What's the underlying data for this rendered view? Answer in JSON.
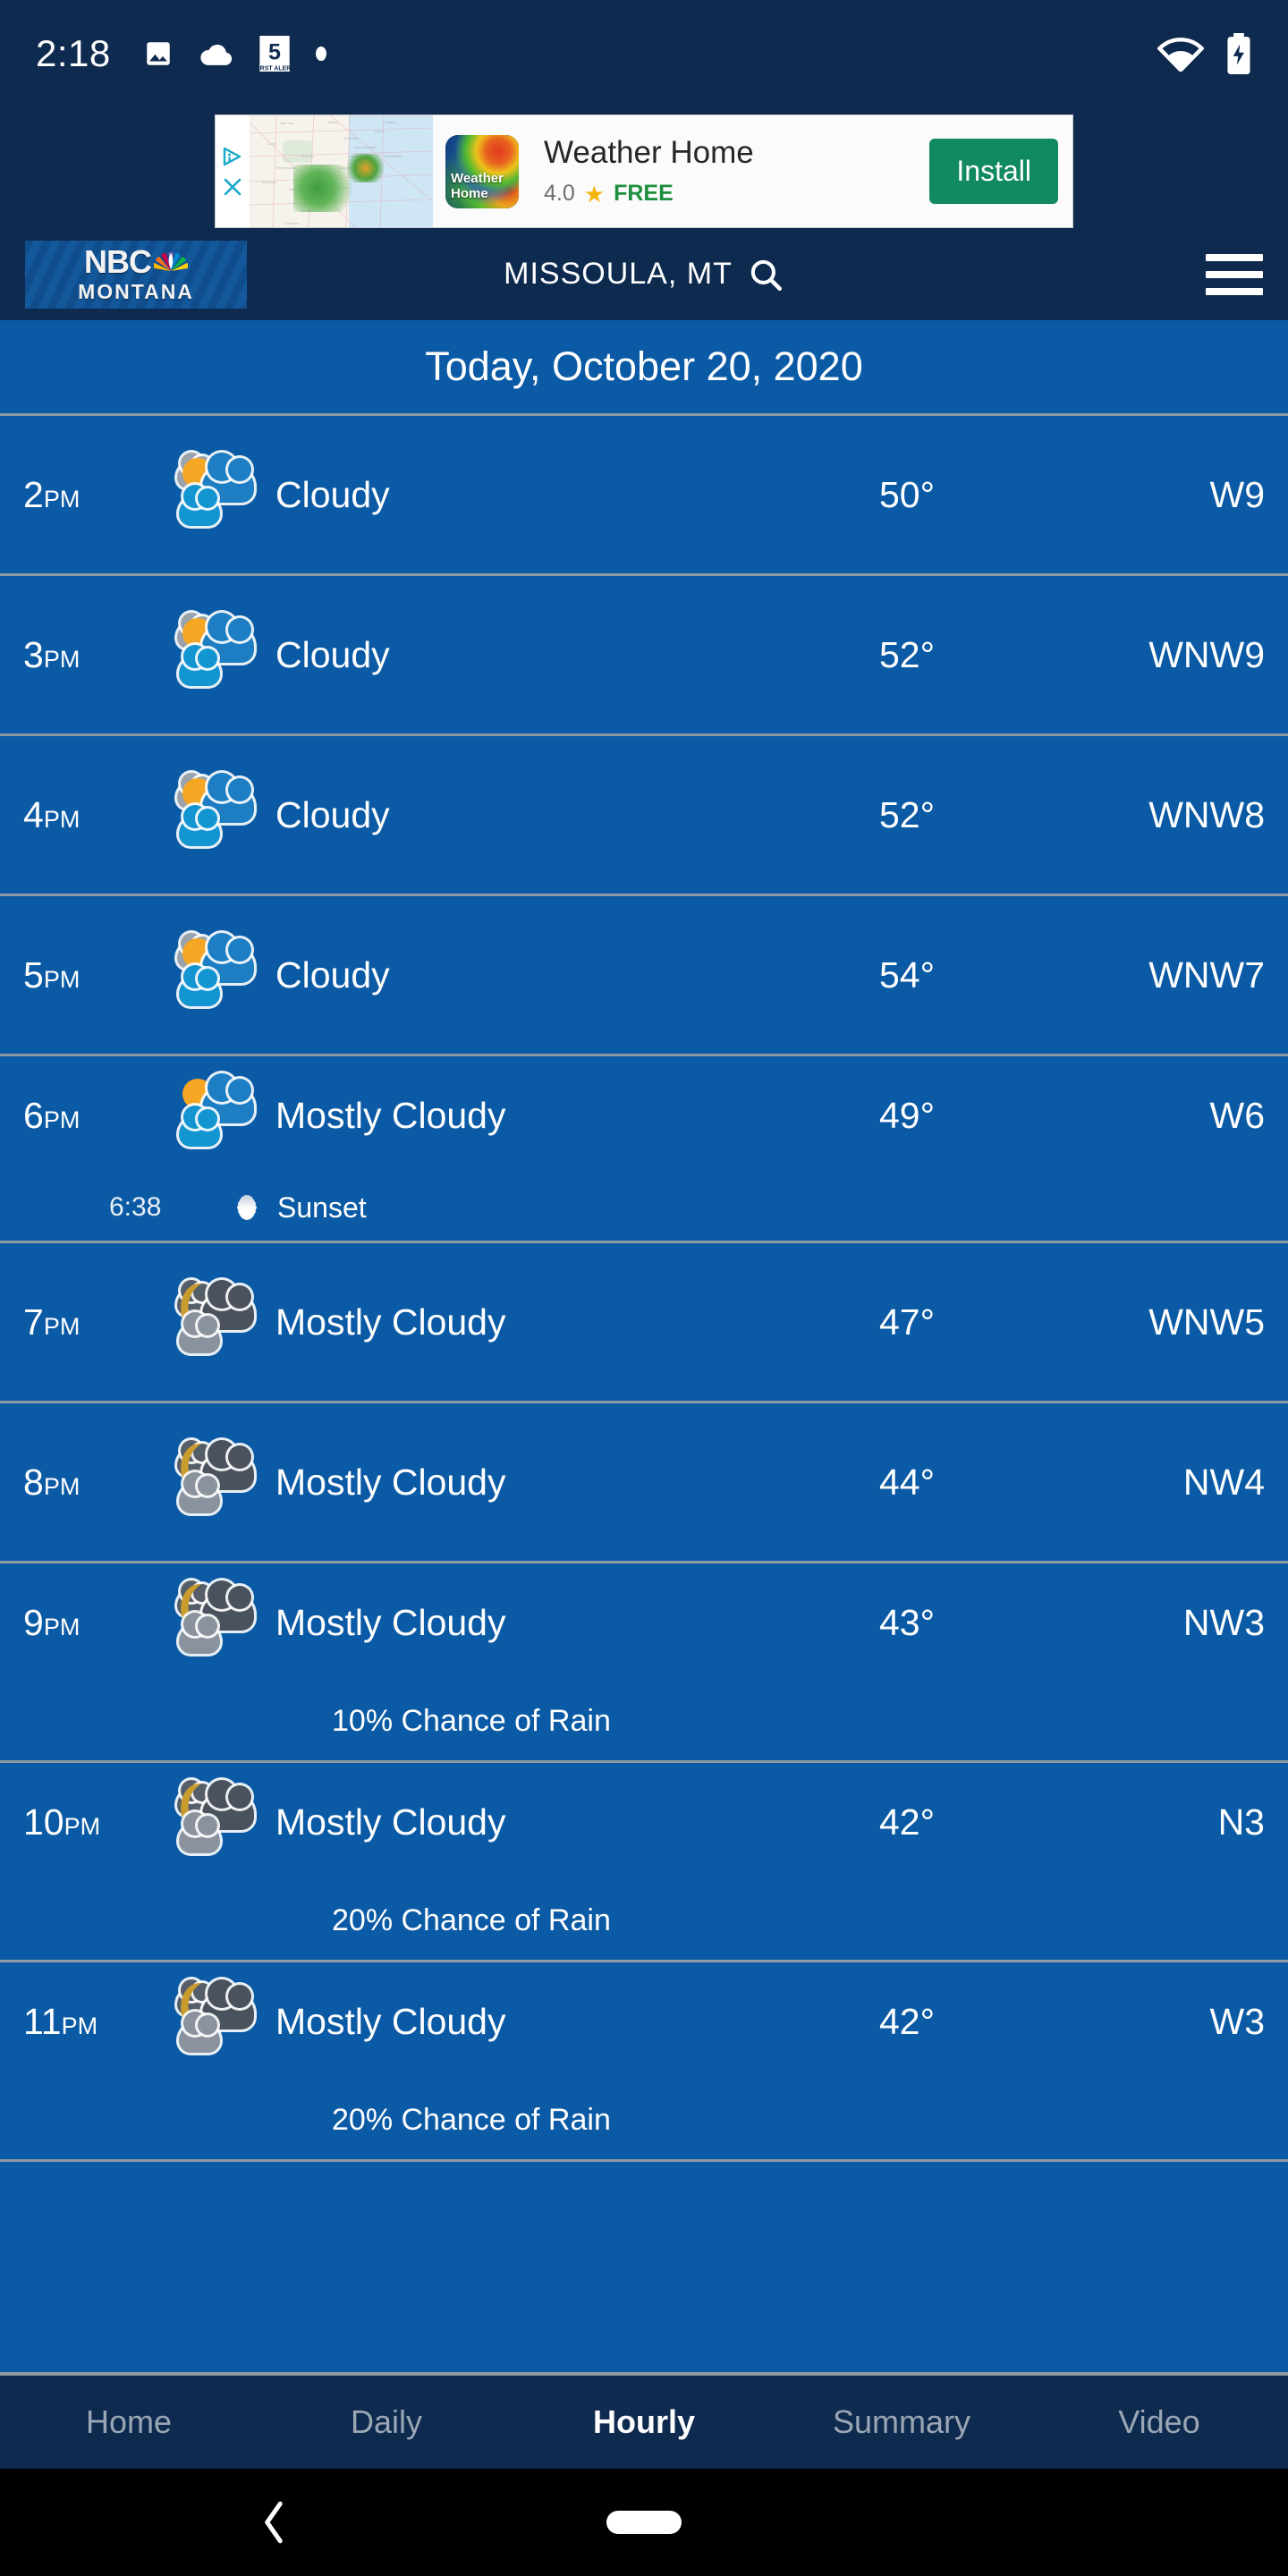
{
  "status_bar": {
    "time": "2:18",
    "left_icons": [
      "image-icon",
      "cloud-icon",
      "first-alert-5-icon",
      "dot-icon"
    ],
    "right_icons": [
      "wifi-icon",
      "battery-charging-icon"
    ]
  },
  "ad": {
    "adchoices_icon": "adchoices-icon",
    "close_icon": "close-icon",
    "app_icon_label": "Weather\nHome",
    "app_icon_line1": "Weather",
    "app_icon_line2": "Home",
    "title": "Weather Home",
    "rating": "4.0",
    "star": "★",
    "price": "FREE",
    "install_label": "Install"
  },
  "app_bar": {
    "brand_primary": "NBC",
    "brand_secondary": "MONTANA",
    "location": "MISSOULA, MT",
    "search_icon": "search-icon",
    "menu_icon": "hamburger-menu-icon"
  },
  "date_header": {
    "title": "Today, October 20, 2020"
  },
  "hourly": {
    "rows": [
      {
        "time": "2",
        "meridiem": "PM",
        "icon": "cloudy-day-icon",
        "condition": "Cloudy",
        "temp": "50°",
        "wind": "W9"
      },
      {
        "time": "3",
        "meridiem": "PM",
        "icon": "cloudy-day-icon",
        "condition": "Cloudy",
        "temp": "52°",
        "wind": "WNW9"
      },
      {
        "time": "4",
        "meridiem": "PM",
        "icon": "cloudy-day-icon",
        "condition": "Cloudy",
        "temp": "52°",
        "wind": "WNW8"
      },
      {
        "time": "5",
        "meridiem": "PM",
        "icon": "cloudy-day-icon",
        "condition": "Cloudy",
        "temp": "54°",
        "wind": "WNW7"
      },
      {
        "time": "6",
        "meridiem": "PM",
        "icon": "mostly-cloudy-day-icon",
        "condition": "Mostly Cloudy",
        "temp": "49°",
        "wind": "W6",
        "sun_event": {
          "time": "6:38",
          "icon": "sunset-icon",
          "label": "Sunset"
        }
      },
      {
        "time": "7",
        "meridiem": "PM",
        "icon": "mostly-cloudy-night-icon",
        "condition": "Mostly Cloudy",
        "temp": "47°",
        "wind": "WNW5"
      },
      {
        "time": "8",
        "meridiem": "PM",
        "icon": "mostly-cloudy-night-icon",
        "condition": "Mostly Cloudy",
        "temp": "44°",
        "wind": "NW4"
      },
      {
        "time": "9",
        "meridiem": "PM",
        "icon": "mostly-cloudy-night-icon",
        "condition": "Mostly Cloudy",
        "temp": "43°",
        "wind": "NW3",
        "precip": "10% Chance of Rain"
      },
      {
        "time": "10",
        "meridiem": "PM",
        "icon": "mostly-cloudy-night-icon",
        "condition": "Mostly Cloudy",
        "temp": "42°",
        "wind": "N3",
        "precip": "20% Chance of Rain"
      },
      {
        "time": "11",
        "meridiem": "PM",
        "icon": "mostly-cloudy-night-icon",
        "condition": "Mostly Cloudy",
        "temp": "42°",
        "wind": "W3",
        "precip": "20% Chance of Rain"
      }
    ]
  },
  "bottom_tabs": {
    "items": [
      {
        "label": "Home",
        "active": false
      },
      {
        "label": "Daily",
        "active": false
      },
      {
        "label": "Hourly",
        "active": true
      },
      {
        "label": "Summary",
        "active": false
      },
      {
        "label": "Video",
        "active": false
      }
    ]
  },
  "android_nav": {
    "back_icon": "back-chevron-icon",
    "home_icon": "home-pill-icon"
  },
  "colors": {
    "navy": "#0E2A4F",
    "body_blue": "#0B5AA5",
    "divider": "#8e9aa3",
    "install_green": "#128a5f",
    "free_green": "#1e8e3e",
    "star_gold": "#f5b50a",
    "sun_gold": "#F5A623",
    "moon_gold": "#C99C2E"
  }
}
